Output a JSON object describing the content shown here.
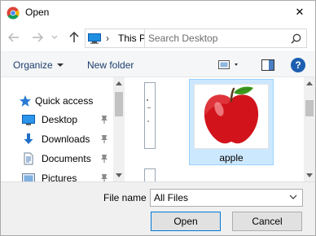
{
  "window": {
    "title": "Open",
    "close_glyph": "✕",
    "app_icon": "chrome-icon"
  },
  "nav": {
    "back_icon": "back-arrow-icon",
    "forward_icon": "forward-arrow-icon",
    "recent_icon": "chevron-down-icon",
    "up_icon": "up-arrow-icon",
    "breadcrumb_separator": "›",
    "breadcrumb_text": "This PC",
    "search_placeholder": "Search Desktop"
  },
  "toolbar": {
    "organize_label": "Organize",
    "new_folder_label": "New folder",
    "help_label": "?"
  },
  "sidebar": {
    "items": [
      {
        "label": "Quick access",
        "icon": "star-icon",
        "pinned": false
      },
      {
        "label": "Desktop",
        "icon": "desktop-icon",
        "pinned": true
      },
      {
        "label": "Downloads",
        "icon": "download-icon",
        "pinned": true
      },
      {
        "label": "Documents",
        "icon": "documents-icon",
        "pinned": true
      },
      {
        "label": "Pictures",
        "icon": "pictures-icon",
        "pinned": true
      }
    ]
  },
  "files": {
    "items": [
      {
        "name": "apple",
        "selected": true,
        "thumbnail": "apple-image"
      }
    ]
  },
  "footer": {
    "file_name_label": "File name",
    "file_type_value": "All Files",
    "open_label": "Open",
    "cancel_label": "Cancel"
  },
  "colors": {
    "accent": "#0078d7",
    "selection_fill": "#cce8ff",
    "link_text": "#1a3e6e",
    "apple_red": "#d2131b",
    "leaf_green": "#3c9a1e"
  }
}
